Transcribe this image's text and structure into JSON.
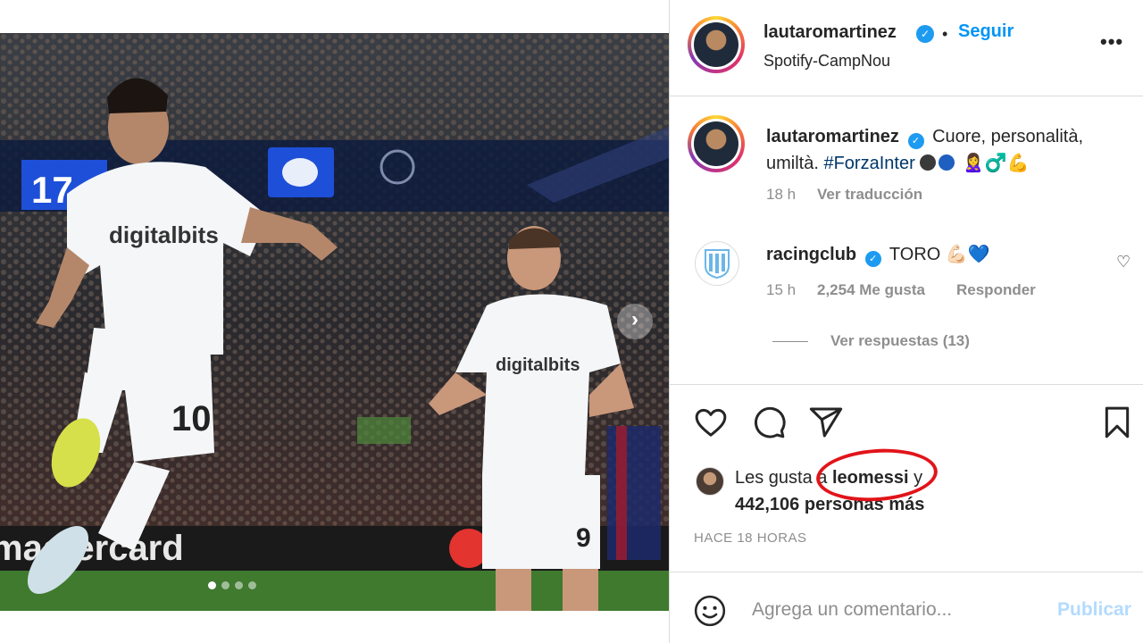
{
  "post": {
    "author": "lautaromartinez",
    "follow_label": "Seguir",
    "location": "Spotify-CampNou",
    "more_label": "•••",
    "media": {
      "slide_count": 4,
      "active_slide": 1,
      "scoreboard_text": "17",
      "board_text": "mastercard",
      "shirt_sponsor": "digitalbits",
      "player_left_number": "10",
      "player_right_number": "9"
    }
  },
  "caption": {
    "username": "lautaromartinez",
    "text_before": "Cuore, personalità, umiltà.",
    "hashtag": "#ForzaInter",
    "emojis": "🙎‍♀️♂️💪",
    "time": "18 h",
    "translate_label": "Ver traducción"
  },
  "comment": {
    "username": "racingclub",
    "text": "TORO 💪🏻💙",
    "time": "15 h",
    "likes": "2,254 Me gusta",
    "reply_label": "Responder",
    "view_replies": "Ver respuestas (13)"
  },
  "likes": {
    "prefix": "Les gusta a",
    "user": "leomessi",
    "suffix": "y",
    "count_line": "442,106 personas más"
  },
  "timestamp": "HACE 18 HORAS",
  "comment_box": {
    "placeholder": "Agrega un comentario...",
    "publish_label": "Publicar"
  },
  "colors": {
    "accent": "#0095f6",
    "verified": "#1d9bf0",
    "highlight": "#e1141a",
    "hashtag": "#00376b"
  }
}
